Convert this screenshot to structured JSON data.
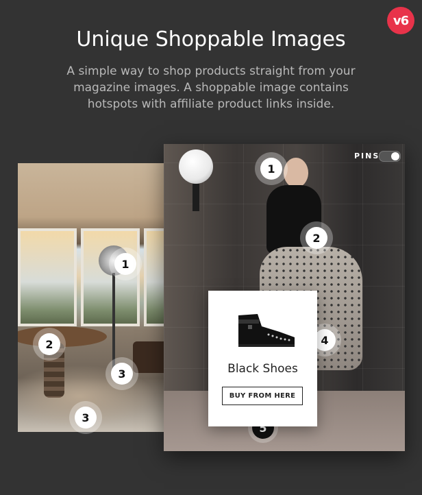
{
  "badge": {
    "label": "v6"
  },
  "header": {
    "title": "Unique Shoppable Images",
    "subtitle": "A simple way to shop products straight from your magazine images. A shoppable image contains hotspots with affiliate product links inside."
  },
  "right_image": {
    "pins_label": "PINS",
    "pins_enabled": true,
    "hotspots": [
      "1",
      "2",
      "4",
      "5"
    ]
  },
  "left_image": {
    "hotspots": [
      "1",
      "2",
      "3",
      "3"
    ]
  },
  "product_card": {
    "name": "Black Shoes",
    "button_label": "BUY FROM HERE"
  },
  "colors": {
    "background": "#333333",
    "accent": "#e8334a"
  }
}
